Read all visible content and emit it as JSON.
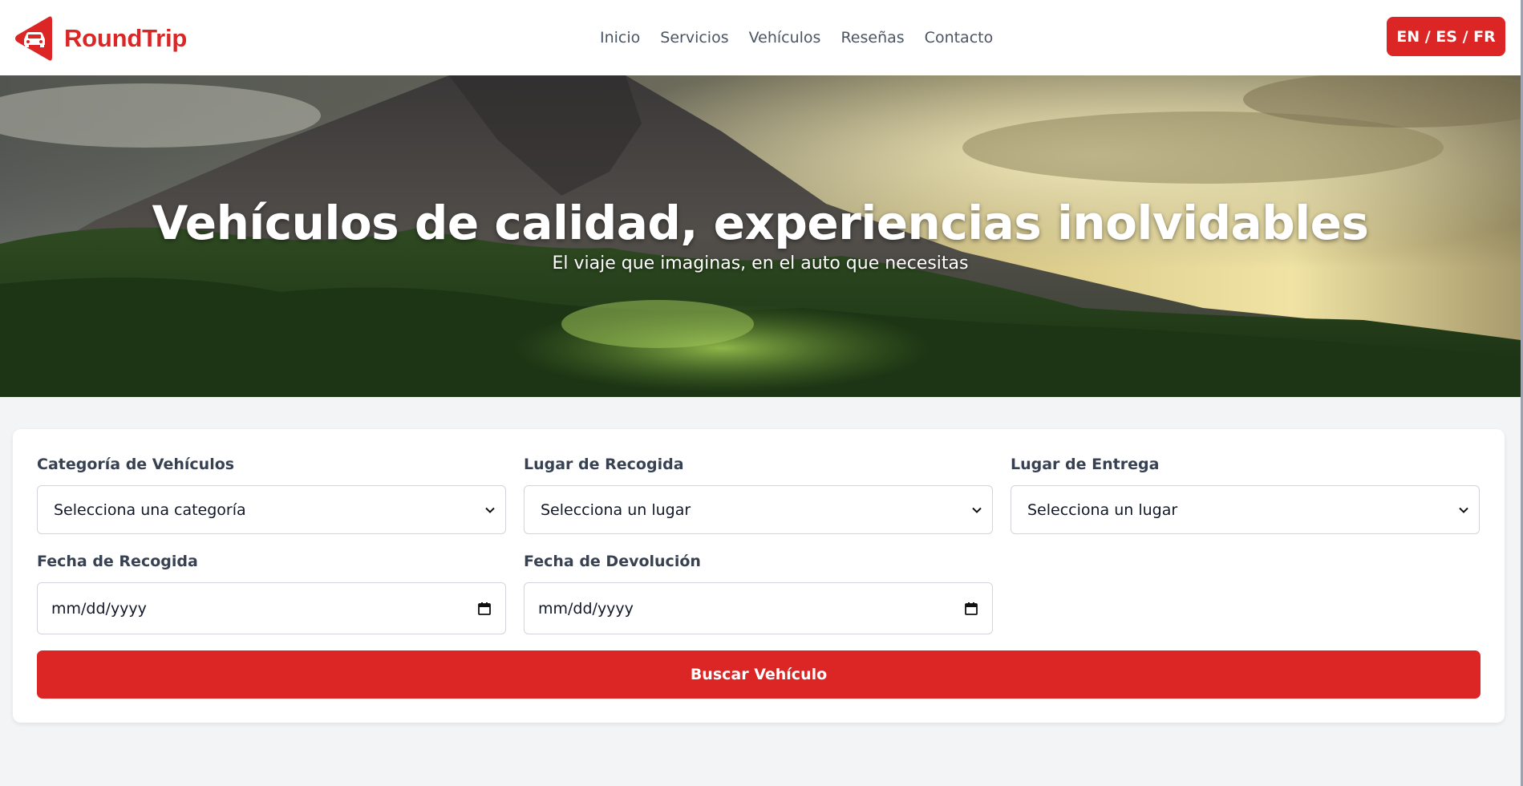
{
  "brand": {
    "name": "RoundTrip",
    "accent": "#dc2626"
  },
  "nav": {
    "items": [
      {
        "label": "Inicio"
      },
      {
        "label": "Servicios"
      },
      {
        "label": "Vehículos"
      },
      {
        "label": "Reseñas"
      },
      {
        "label": "Contacto"
      }
    ]
  },
  "language_button": {
    "label": "EN / ES / FR"
  },
  "hero": {
    "title": "Vehículos de calidad, experiencias inolvidables",
    "subtitle": "El viaje que imaginas, en el auto que necesitas"
  },
  "search_form": {
    "category": {
      "label": "Categoría de Vehículos",
      "value": "Selecciona una categoría"
    },
    "pickup_place": {
      "label": "Lugar de Recogida",
      "value": "Selecciona un lugar"
    },
    "dropoff_place": {
      "label": "Lugar de Entrega",
      "value": "Selecciona un lugar"
    },
    "pickup_date": {
      "label": "Fecha de Recogida",
      "placeholder": "mm/dd/yyyy"
    },
    "return_date": {
      "label": "Fecha de Devolución",
      "placeholder": "mm/dd/yyyy"
    },
    "submit_label": "Buscar Vehículo"
  },
  "icons": {
    "logo": "car-in-triangle-icon",
    "select": "chevron-down-icon",
    "date": "calendar-icon"
  }
}
